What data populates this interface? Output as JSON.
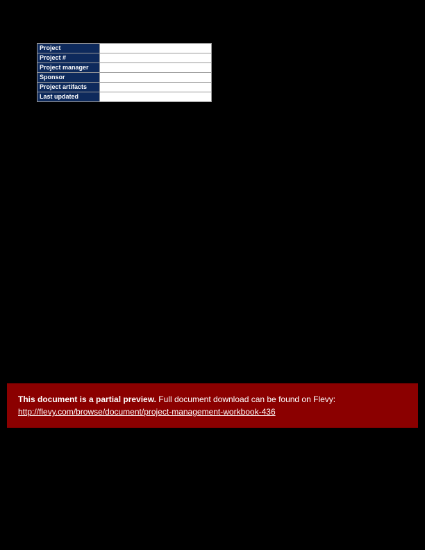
{
  "table": {
    "rows": [
      {
        "label": "Project",
        "value": ""
      },
      {
        "label": "Project #",
        "value": ""
      },
      {
        "label": "Project manager",
        "value": ""
      },
      {
        "label": "Sponsor",
        "value": ""
      },
      {
        "label": "Project artifacts",
        "value": ""
      },
      {
        "label": "Last updated",
        "value": ""
      }
    ]
  },
  "banner": {
    "bold": "This document is a partial preview.",
    "rest": "  Full document download can be found on Flevy:",
    "link": "http://flevy.com/browse/document/project-management-workbook-436"
  }
}
